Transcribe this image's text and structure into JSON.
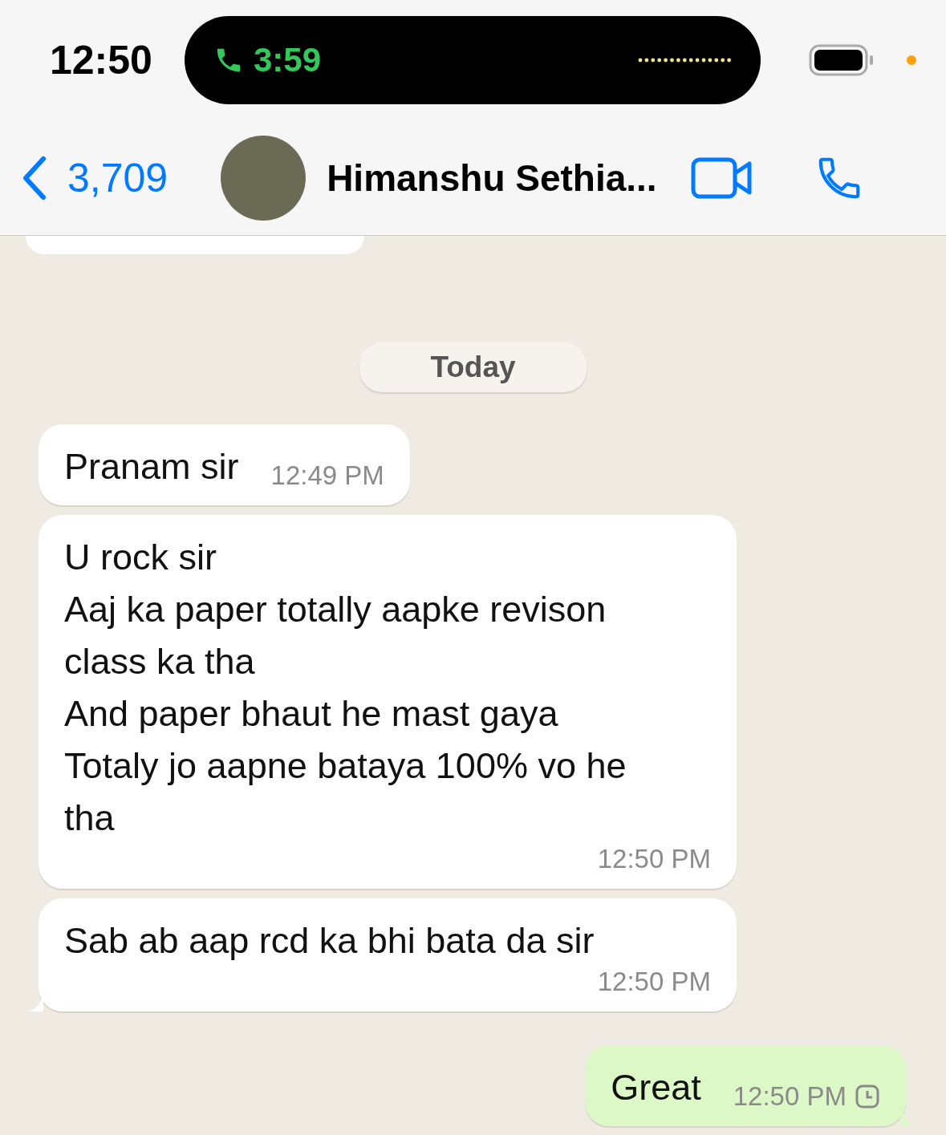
{
  "status_bar": {
    "time": "12:50",
    "call_timer": "3:59"
  },
  "header": {
    "back_count": "3,709",
    "contact_name": "Himanshu Sethia..."
  },
  "date_separator": "Today",
  "messages": [
    {
      "outgoing": false,
      "text": "Pranam sir",
      "time": "12:49 PM",
      "tail": false
    },
    {
      "outgoing": false,
      "text": "U rock sir\nAaj ka paper totally aapke revison\nclass ka tha\nAnd paper bhaut he mast gaya\nTotaly jo aapne bataya 100% vo he\ntha",
      "time": "12:50 PM",
      "tail": false
    },
    {
      "outgoing": false,
      "text": "Sab ab aap rcd ka bhi bata da sir",
      "time": "12:50 PM",
      "tail": true
    },
    {
      "outgoing": true,
      "text": "Great",
      "time": "12:50 PM",
      "pending": true,
      "tail": true
    }
  ]
}
